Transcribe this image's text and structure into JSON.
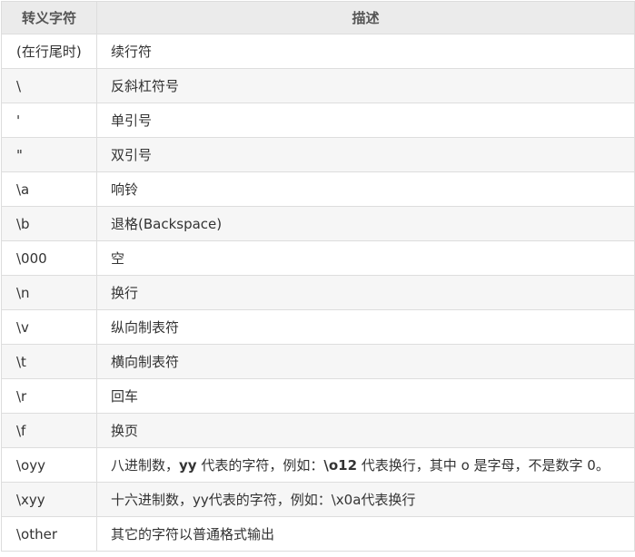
{
  "header": {
    "col_char": "转义字符",
    "col_desc": "描述"
  },
  "rows": [
    {
      "char": "(在行尾时)",
      "desc": [
        "续行符"
      ]
    },
    {
      "char": "\\",
      "desc": [
        "反斜杠符号"
      ]
    },
    {
      "char": "'",
      "desc": [
        "单引号"
      ]
    },
    {
      "char": "\"",
      "desc": [
        "双引号"
      ]
    },
    {
      "char": "\\a",
      "desc": [
        "响铃"
      ]
    },
    {
      "char": "\\b",
      "desc": [
        "退格(Backspace)"
      ]
    },
    {
      "char": "\\000",
      "desc": [
        "空"
      ]
    },
    {
      "char": "\\n",
      "desc": [
        "换行"
      ]
    },
    {
      "char": "\\v",
      "desc": [
        "纵向制表符"
      ]
    },
    {
      "char": "\\t",
      "desc": [
        "横向制表符"
      ]
    },
    {
      "char": "\\r",
      "desc": [
        "回车"
      ]
    },
    {
      "char": "\\f",
      "desc": [
        "换页"
      ]
    },
    {
      "char": "\\oyy",
      "desc": [
        "八进制数，",
        "yy",
        " 代表的字符，例如：",
        "\\o12",
        " 代表换行，其中 o 是字母，不是数字 0。"
      ]
    },
    {
      "char": "\\xyy",
      "desc": [
        "十六进制数，yy代表的字符，例如：\\x0a代表换行"
      ]
    },
    {
      "char": "\\other",
      "desc": [
        "其它的字符以普通格式输出"
      ]
    }
  ]
}
